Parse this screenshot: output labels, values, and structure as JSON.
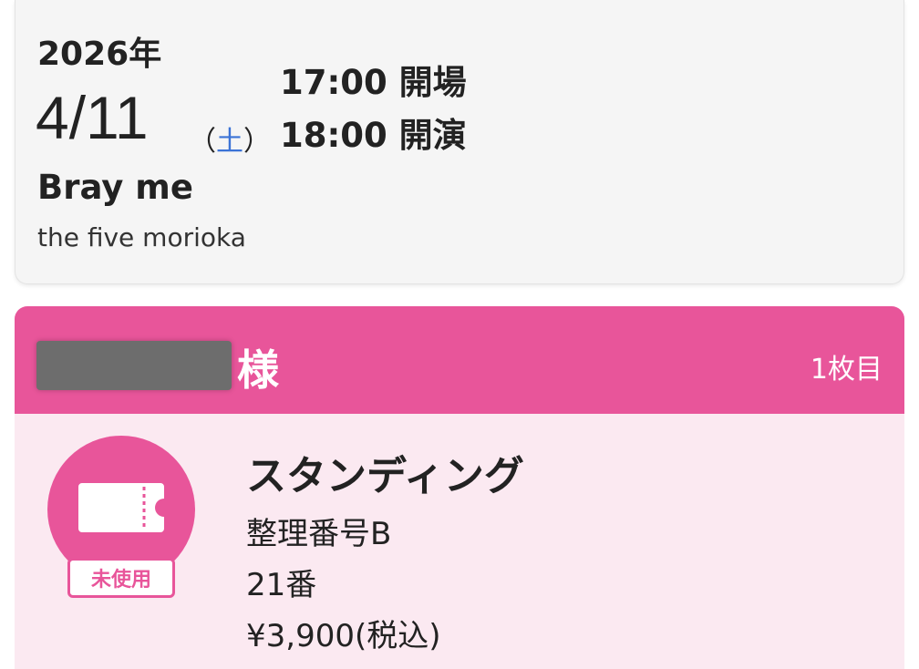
{
  "event": {
    "year": "2026年",
    "date": "4/11",
    "weekday_open": "（",
    "weekday": "土",
    "weekday_close": "）",
    "open_time": "17:00 開場",
    "start_time": "18:00 開演",
    "artist": "Bray me",
    "venue": "the five morioka"
  },
  "ticket": {
    "honorific": "様",
    "count": "1枚目",
    "status": "未使用",
    "seat_type": "スタンディング",
    "reference": "整理番号B",
    "number": "21番",
    "price": "¥3,900(税込)",
    "icon": "ticket-icon"
  },
  "colors": {
    "accent": "#e8559a",
    "ticket_body": "#fbe9f1",
    "weekday": "#3b73d6"
  }
}
